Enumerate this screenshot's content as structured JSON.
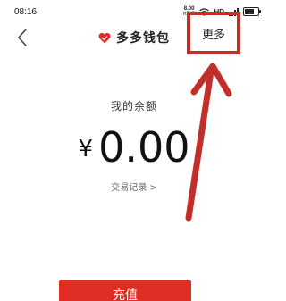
{
  "status_bar": {
    "time": "08:16",
    "net_speed_value": "8.00",
    "net_speed_unit": "KB/S",
    "network_tag": "HD"
  },
  "nav": {
    "title": "多多钱包",
    "more_label": "更多"
  },
  "balance": {
    "label": "我的余额",
    "currency": "¥",
    "amount": "0.00"
  },
  "history": {
    "label": "交易记录",
    "chevron": ">"
  },
  "actions": {
    "recharge_label": "充值"
  },
  "colors": {
    "annotation": "#c22f2a",
    "brand_red": "#e02e24"
  },
  "battery_level": 0.72
}
